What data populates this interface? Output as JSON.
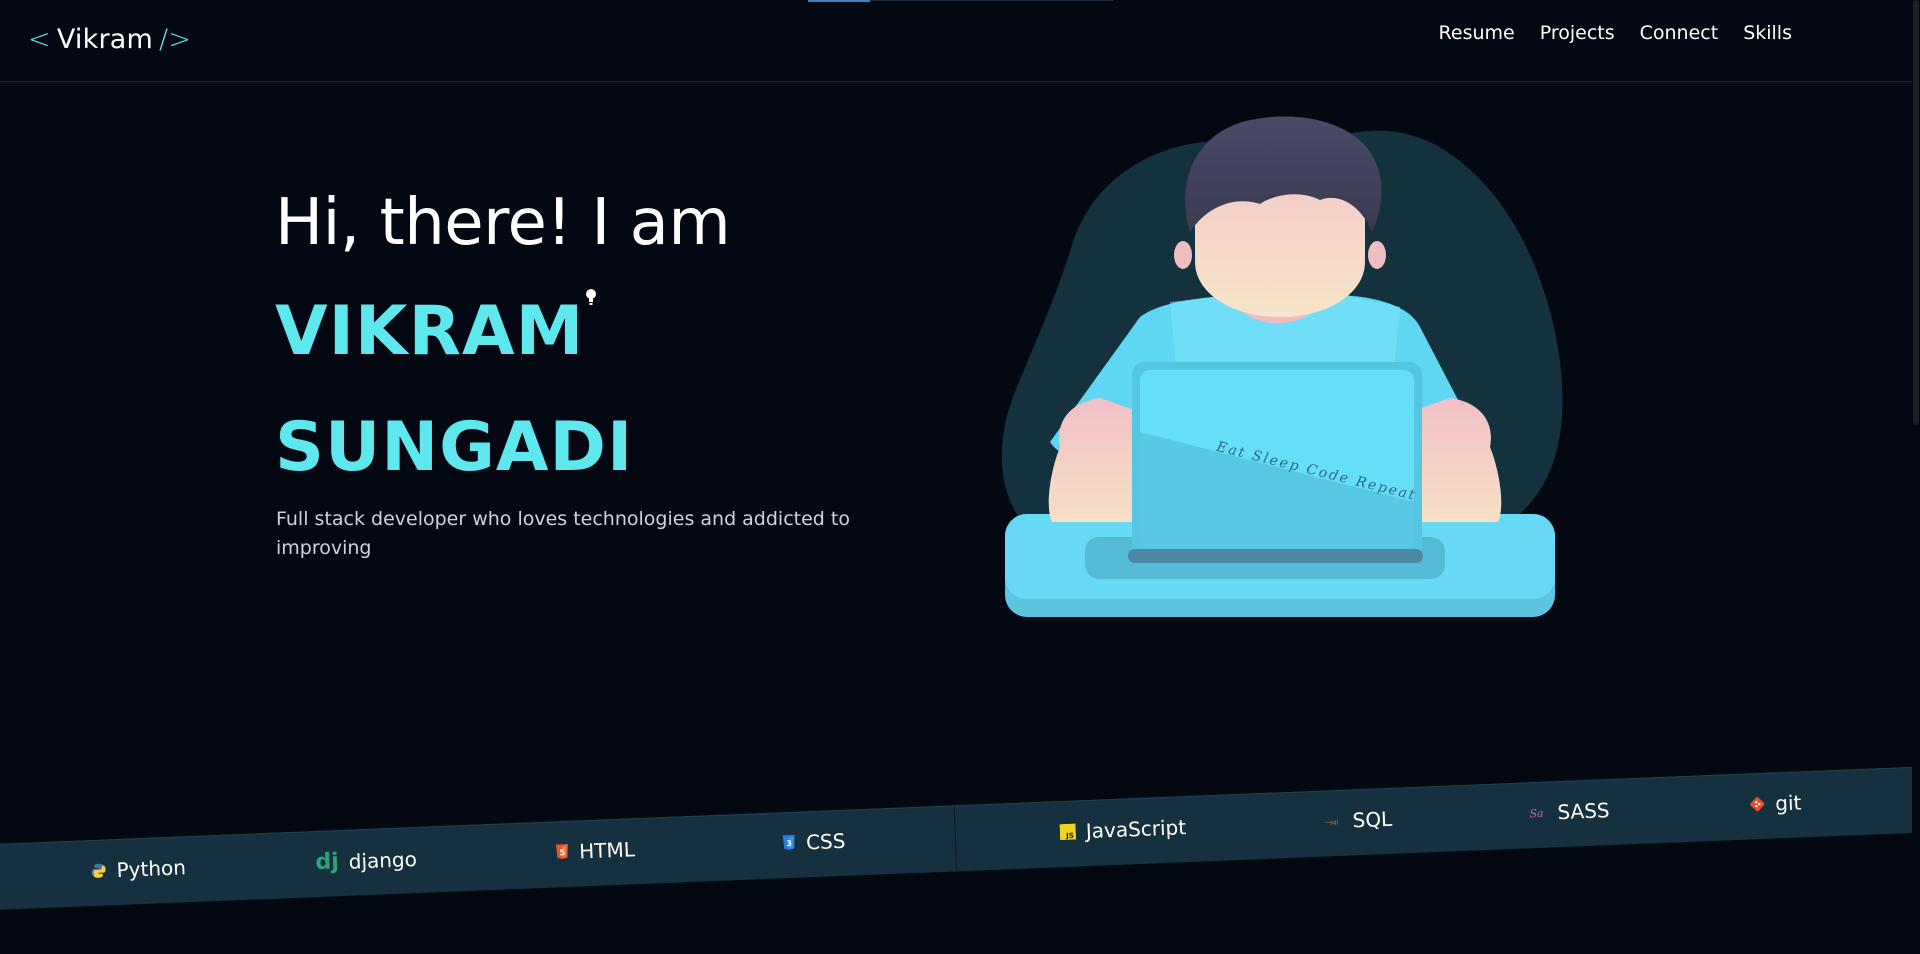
{
  "logo": {
    "open": "<",
    "name": "Vikram",
    "close": "/>"
  },
  "nav": [
    {
      "label": "Resume"
    },
    {
      "label": "Projects"
    },
    {
      "label": "Connect"
    },
    {
      "label": "Skills"
    }
  ],
  "hero": {
    "greeting": "Hi, there! I am",
    "first_name": "VIKRAM",
    "last_name": "SUNGADI",
    "tagline": "Full stack developer who loves technologies and addicted to improving"
  },
  "illustration": {
    "laptop_text": "Eat Sleep Code Repeat"
  },
  "skills": [
    {
      "label": "Python",
      "icon": "python-icon"
    },
    {
      "label": "django",
      "icon": "django-icon"
    },
    {
      "label": "HTML",
      "icon": "html5-icon"
    },
    {
      "label": "CSS",
      "icon": "css3-icon"
    },
    {
      "label": "JavaScript",
      "icon": "javascript-icon"
    },
    {
      "label": "SQL",
      "icon": "sql-icon"
    },
    {
      "label": "SASS",
      "icon": "sass-icon"
    },
    {
      "label": "git",
      "icon": "git-icon"
    }
  ],
  "colors": {
    "background": "#040812",
    "accent": "#5ee8ee",
    "band": "#15313f",
    "blob": "#14323e"
  }
}
